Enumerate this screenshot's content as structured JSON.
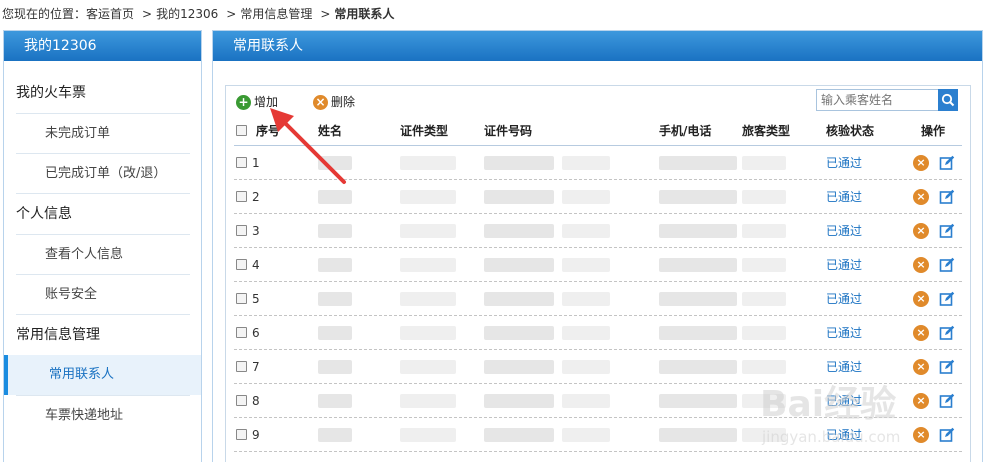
{
  "breadcrumb": {
    "prefix": "您现在的位置：",
    "items": [
      "客运首页",
      "我的12306",
      "常用信息管理",
      "常用联系人"
    ],
    "separator": ">"
  },
  "sidebar": {
    "title": "我的12306",
    "groups": [
      {
        "label": "我的火车票",
        "items": [
          "未完成订单",
          "已完成订单（改/退）"
        ]
      },
      {
        "label": "个人信息",
        "items": [
          "查看个人信息",
          "账号安全"
        ]
      },
      {
        "label": "常用信息管理",
        "items": [
          "常用联系人",
          "车票快递地址"
        ]
      }
    ],
    "active_item": "常用联系人"
  },
  "main": {
    "title": "常用联系人",
    "toolbar": {
      "add_label": "增加",
      "delete_label": "删除",
      "search_placeholder": "输入乘客姓名"
    },
    "table": {
      "columns": [
        "序号",
        "姓名",
        "证件类型",
        "证件号码",
        "手机/电话",
        "旅客类型",
        "核验状态",
        "操作"
      ],
      "rows": [
        {
          "index": "1",
          "status": "已通过"
        },
        {
          "index": "2",
          "status": "已通过"
        },
        {
          "index": "3",
          "status": "已通过"
        },
        {
          "index": "4",
          "status": "已通过"
        },
        {
          "index": "5",
          "status": "已通过"
        },
        {
          "index": "6",
          "status": "已通过"
        },
        {
          "index": "7",
          "status": "已通过"
        },
        {
          "index": "8",
          "status": "已通过"
        },
        {
          "index": "9",
          "status": "已通过"
        }
      ]
    }
  },
  "watermark": {
    "text": "Bai经验",
    "sub": "jingyan.baidu.com"
  },
  "colors": {
    "accent": "#1a72c2",
    "header_gradient_top": "#3d98dd",
    "add_icon": "#3a9a33",
    "delete_icon": "#e08a2b"
  }
}
